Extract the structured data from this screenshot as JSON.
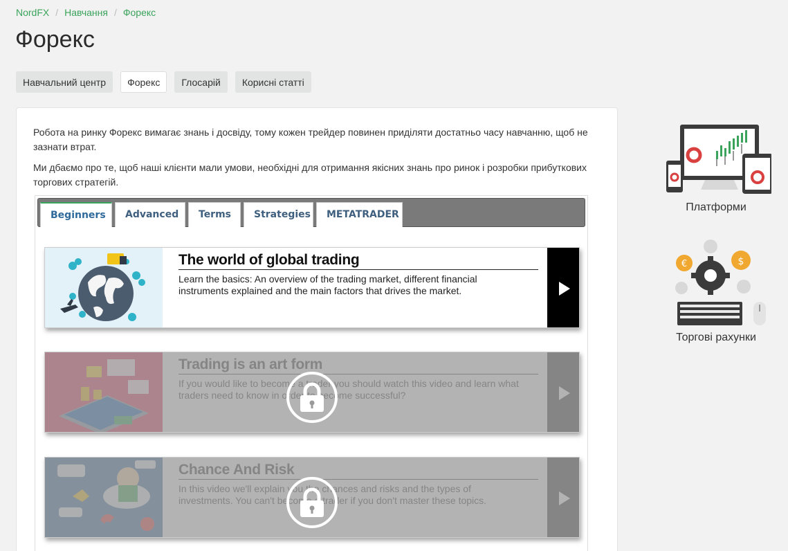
{
  "breadcrumb": {
    "items": [
      "NordFX",
      "Навчання",
      "Форекс"
    ],
    "separator": "/"
  },
  "page_title": "Форекс",
  "subnav": {
    "items": [
      "Навчальний центр",
      "Форекс",
      "Глосарій",
      "Корисні статті"
    ],
    "active": "Форекс"
  },
  "intro": {
    "p1": "Робота на ринку Форекс вимагає знань і досвіду, тому кожен трейдер повинен приділяти достатньо часу навчанню, щоб не зазнати втрат.",
    "p2": "Ми дбаємо про те, щоб наші клієнти мали умови, необхідні для отримання якісних знань про ринок і розробки прибуткових торгових стратегій."
  },
  "tabs": {
    "items": [
      "Beginners",
      "Advanced",
      "Terms",
      "Strategies",
      "METATRADER"
    ],
    "active": "Beginners"
  },
  "lessons": [
    {
      "title": "The world of global trading",
      "desc": "Learn the basics: An overview of the trading market, different financial instruments explained and the main factors that drives the market.",
      "locked": false,
      "thumb_color": "#dbeef7"
    },
    {
      "title": "Trading is an art form",
      "desc": "If you would like to become a trader you should watch this video and learn what traders need to know in order to become successful?",
      "locked": true,
      "thumb_color": "#d34d6d"
    },
    {
      "title": "Chance And Risk",
      "desc": "In this video we'll explain you the chances and risks and the types of investments. You can't become a trader if you don't master these topics.",
      "locked": true,
      "thumb_color": "#4d77a3"
    }
  ],
  "sidebar": {
    "platforms_label": "Платформи",
    "accounts_label": "Торгові рахунки"
  },
  "colors": {
    "accent": "#3aa35b",
    "tab_text": "#3f5f7f",
    "page_bg": "#f2f2f2"
  }
}
